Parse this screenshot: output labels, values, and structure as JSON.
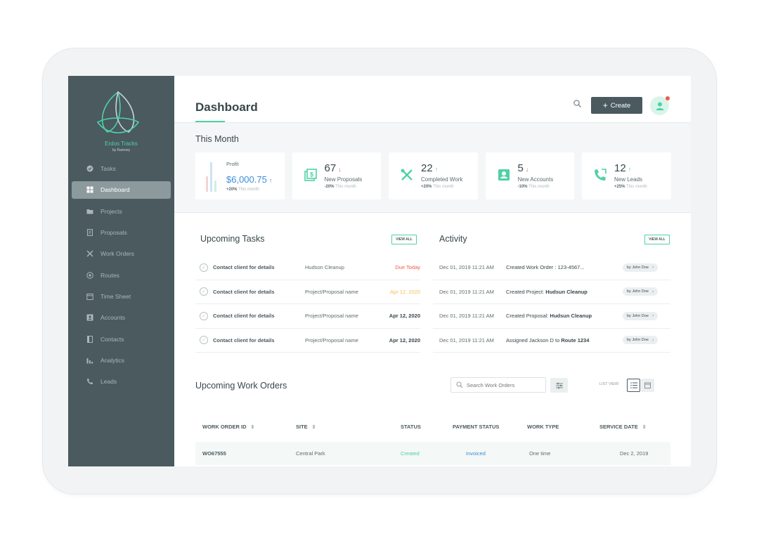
{
  "brand": {
    "name": "Erdos Tracks",
    "sub": "by Ramoey"
  },
  "sidebar": {
    "items": [
      {
        "label": "Tasks",
        "icon": "check-circle-icon"
      },
      {
        "label": "Dashboard",
        "icon": "grid-icon",
        "active": true
      },
      {
        "label": "Projects",
        "icon": "folder-icon"
      },
      {
        "label": "Proposals",
        "icon": "document-icon"
      },
      {
        "label": "Work Orders",
        "icon": "tools-icon"
      },
      {
        "label": "Routes",
        "icon": "route-icon"
      },
      {
        "label": "Time Sheet",
        "icon": "calendar-icon"
      },
      {
        "label": "Accounts",
        "icon": "account-icon"
      },
      {
        "label": "Contacts",
        "icon": "contact-book-icon"
      },
      {
        "label": "Analytics",
        "icon": "bar-chart-icon"
      },
      {
        "label": "Leads",
        "icon": "phone-icon"
      }
    ]
  },
  "header": {
    "title": "Dashboard",
    "create_label": "Create"
  },
  "this_month": {
    "title": "This Month",
    "profit": {
      "label": "Profit",
      "value": "$6,000.75",
      "trend": "up",
      "change": "+20%",
      "period": "This month"
    },
    "cards": [
      {
        "value": "67",
        "trend": "down",
        "label": "New Proposals",
        "change": "-20%",
        "period": "This month",
        "icon": "money-icon"
      },
      {
        "value": "22",
        "trend": "up",
        "label": "Completed Work",
        "change": "+20%",
        "period": "This month",
        "icon": "tools-icon"
      },
      {
        "value": "5",
        "trend": "down",
        "label": "New Accounts",
        "change": "-10%",
        "period": "This month",
        "icon": "account-icon"
      },
      {
        "value": "12",
        "trend": "up",
        "label": "New Leads",
        "change": "+25%",
        "period": "This month",
        "icon": "phone-icon"
      }
    ]
  },
  "tasks": {
    "title": "Upcoming Tasks",
    "view_all": "VIEW ALL",
    "rows": [
      {
        "name": "Contact client for details",
        "project": "Hudson Cleanup",
        "due": "Due Today",
        "due_style": "red"
      },
      {
        "name": "Contact client for details",
        "project": "Project/Proposal name",
        "due": "Apr 12, 2020",
        "due_style": "yellow"
      },
      {
        "name": "Contact client for details",
        "project": "Project/Proposal name",
        "due": "Apr 12, 2020",
        "due_style": "dark"
      },
      {
        "name": "Contact client for details",
        "project": "Project/Proposal name",
        "due": "Apr 12, 2020",
        "due_style": "dark"
      }
    ]
  },
  "activity": {
    "title": "Activity",
    "view_all": "VIEW ALL",
    "rows": [
      {
        "date": "Dec 01, 2019 11:21 AM",
        "text": "Created Work Order : 123-4567...",
        "bold": "",
        "user": "by John Doe"
      },
      {
        "date": "Dec 01, 2019 11:21 AM",
        "text": "Created Project: ",
        "bold": "Hudsun Cleanup",
        "user": "by John Doe"
      },
      {
        "date": "Dec 01, 2019 11:21 AM",
        "text": "Created Proposal: ",
        "bold": "Hudsun Cleanup",
        "user": "by John Doe"
      },
      {
        "date": "Dec 01, 2019 11:21 AM",
        "text": "Assigned Jackson D to ",
        "bold": "Route 1234",
        "user": "by John Doe"
      }
    ]
  },
  "work_orders": {
    "title": "Upcoming Work Orders",
    "search_placeholder": "Search Work Orders",
    "list_view_label": "LIST VIEW",
    "columns": [
      "WORK ORDER ID",
      "SITE",
      "STATUS",
      "PAYMENT STATUS",
      "WORK TYPE",
      "SERVICE DATE"
    ],
    "rows": [
      {
        "id": "WO67555",
        "site": "Central Park",
        "status": "Created",
        "payment": "Invoiced",
        "work_type": "One time",
        "date": "Dec 2, 2019"
      }
    ]
  },
  "colors": {
    "accent": "#4fd1a5",
    "sidebar": "#4a5a5f",
    "blue": "#3a8fd9",
    "red": "#ef5a4c",
    "yellow": "#f3c04d"
  }
}
